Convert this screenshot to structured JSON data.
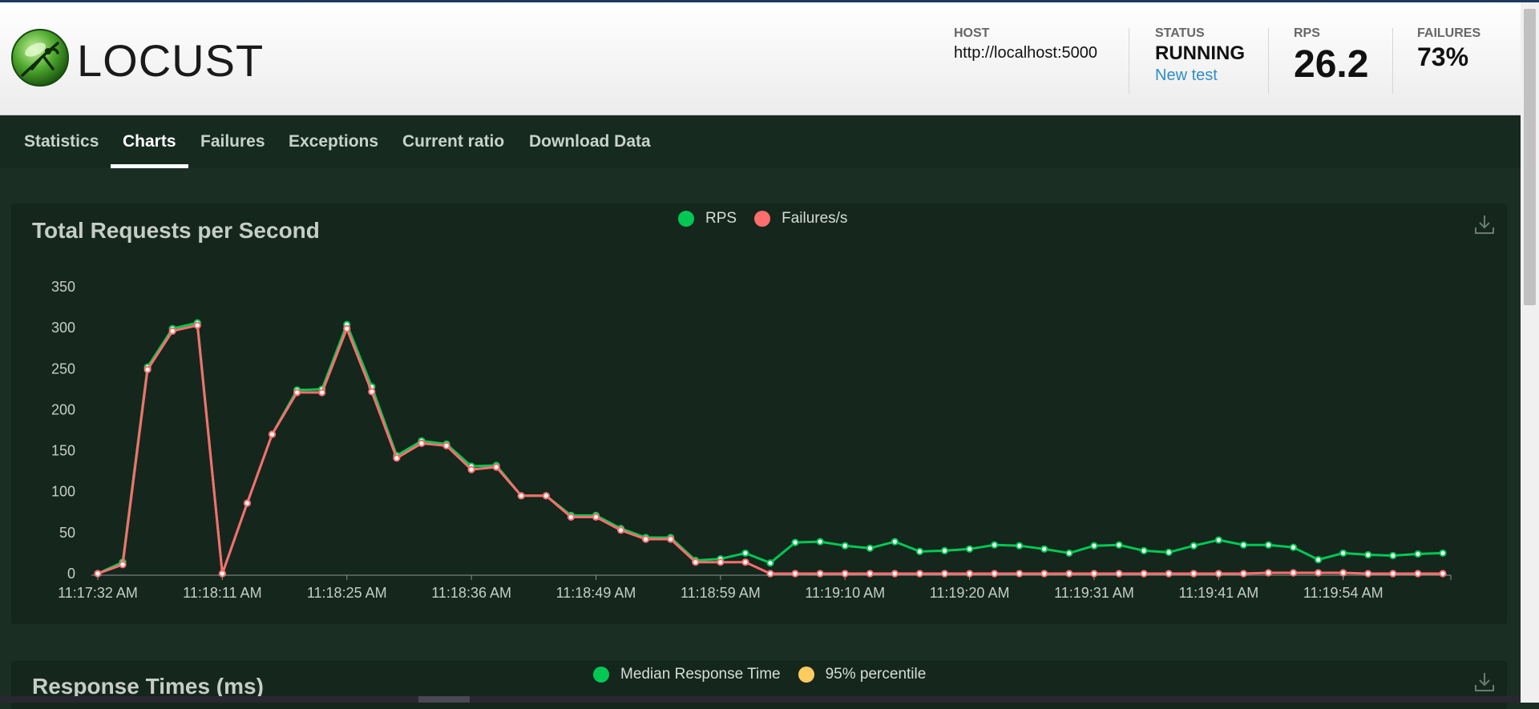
{
  "app": {
    "logo_text": "LOCUST",
    "logo_icon": "locust-icon"
  },
  "stats": {
    "host_label": "HOST",
    "host_value": "http://localhost:5000",
    "status_label": "STATUS",
    "status_value": "RUNNING",
    "new_test_label": "New test",
    "rps_label": "RPS",
    "rps_value": "26.2",
    "failures_label": "FAILURES",
    "failures_value": "73%"
  },
  "nav": {
    "tabs": [
      {
        "label": "Statistics"
      },
      {
        "label": "Charts",
        "active": true
      },
      {
        "label": "Failures"
      },
      {
        "label": "Exceptions"
      },
      {
        "label": "Current ratio"
      },
      {
        "label": "Download Data"
      }
    ]
  },
  "rps_chart": {
    "title": "Total Requests per Second",
    "legend": [
      {
        "label": "RPS",
        "color": "#00c853"
      },
      {
        "label": "Failures/s",
        "color": "#ff6d6d"
      }
    ],
    "download_icon": "download-icon"
  },
  "response_chart": {
    "title": "Response Times (ms)",
    "legend": [
      {
        "label": "Median Response Time",
        "color": "#00c853"
      },
      {
        "label": "95% percentile",
        "color": "#ffca5f"
      }
    ],
    "download_icon": "download-icon"
  },
  "colors": {
    "rps": "#00c853",
    "failures": "#ff6d6d",
    "percentile": "#ffca5f",
    "accent_link": "#2f8ec6"
  },
  "chart_data": {
    "type": "line",
    "title": "Total Requests per Second",
    "ylim": [
      0,
      350
    ],
    "yticks": [
      0,
      50,
      100,
      150,
      200,
      250,
      300,
      350
    ],
    "x_tick_labels": [
      "11:17:32 AM",
      "11:18:11 AM",
      "11:18:25 AM",
      "11:18:36 AM",
      "11:18:49 AM",
      "11:18:59 AM",
      "11:19:10 AM",
      "11:19:20 AM",
      "11:19:31 AM",
      "11:19:41 AM",
      "11:19:54 AM"
    ],
    "x_tick_index": [
      0,
      5,
      10,
      15,
      20,
      25,
      30,
      35,
      40,
      45,
      50
    ],
    "legend_position": "top-center",
    "series": [
      {
        "name": "RPS",
        "color": "#00c853",
        "values": [
          0,
          14,
          252,
          299,
          306,
          0,
          86,
          170,
          224,
          225,
          304,
          228,
          144,
          162,
          158,
          131,
          132,
          95,
          95,
          71,
          71,
          55,
          44,
          44,
          16,
          18,
          25,
          13,
          38,
          39,
          34,
          31,
          39,
          27,
          28,
          30,
          35,
          34,
          30,
          25,
          34,
          35,
          28,
          26,
          34,
          41,
          35,
          35,
          32,
          17,
          25,
          23,
          22,
          24,
          25
        ]
      },
      {
        "name": "Failures/s",
        "color": "#ff6d6d",
        "values": [
          0,
          11,
          249,
          296,
          303,
          0,
          86,
          170,
          221,
          221,
          299,
          222,
          141,
          159,
          156,
          127,
          130,
          95,
          95,
          69,
          69,
          53,
          42,
          42,
          14,
          14,
          14,
          0,
          0,
          0,
          0,
          0,
          0,
          0,
          0,
          0,
          0,
          0,
          0,
          0,
          0,
          0,
          0,
          0,
          0,
          0,
          0,
          1,
          1,
          1,
          1,
          0,
          0,
          0,
          0
        ]
      }
    ]
  }
}
